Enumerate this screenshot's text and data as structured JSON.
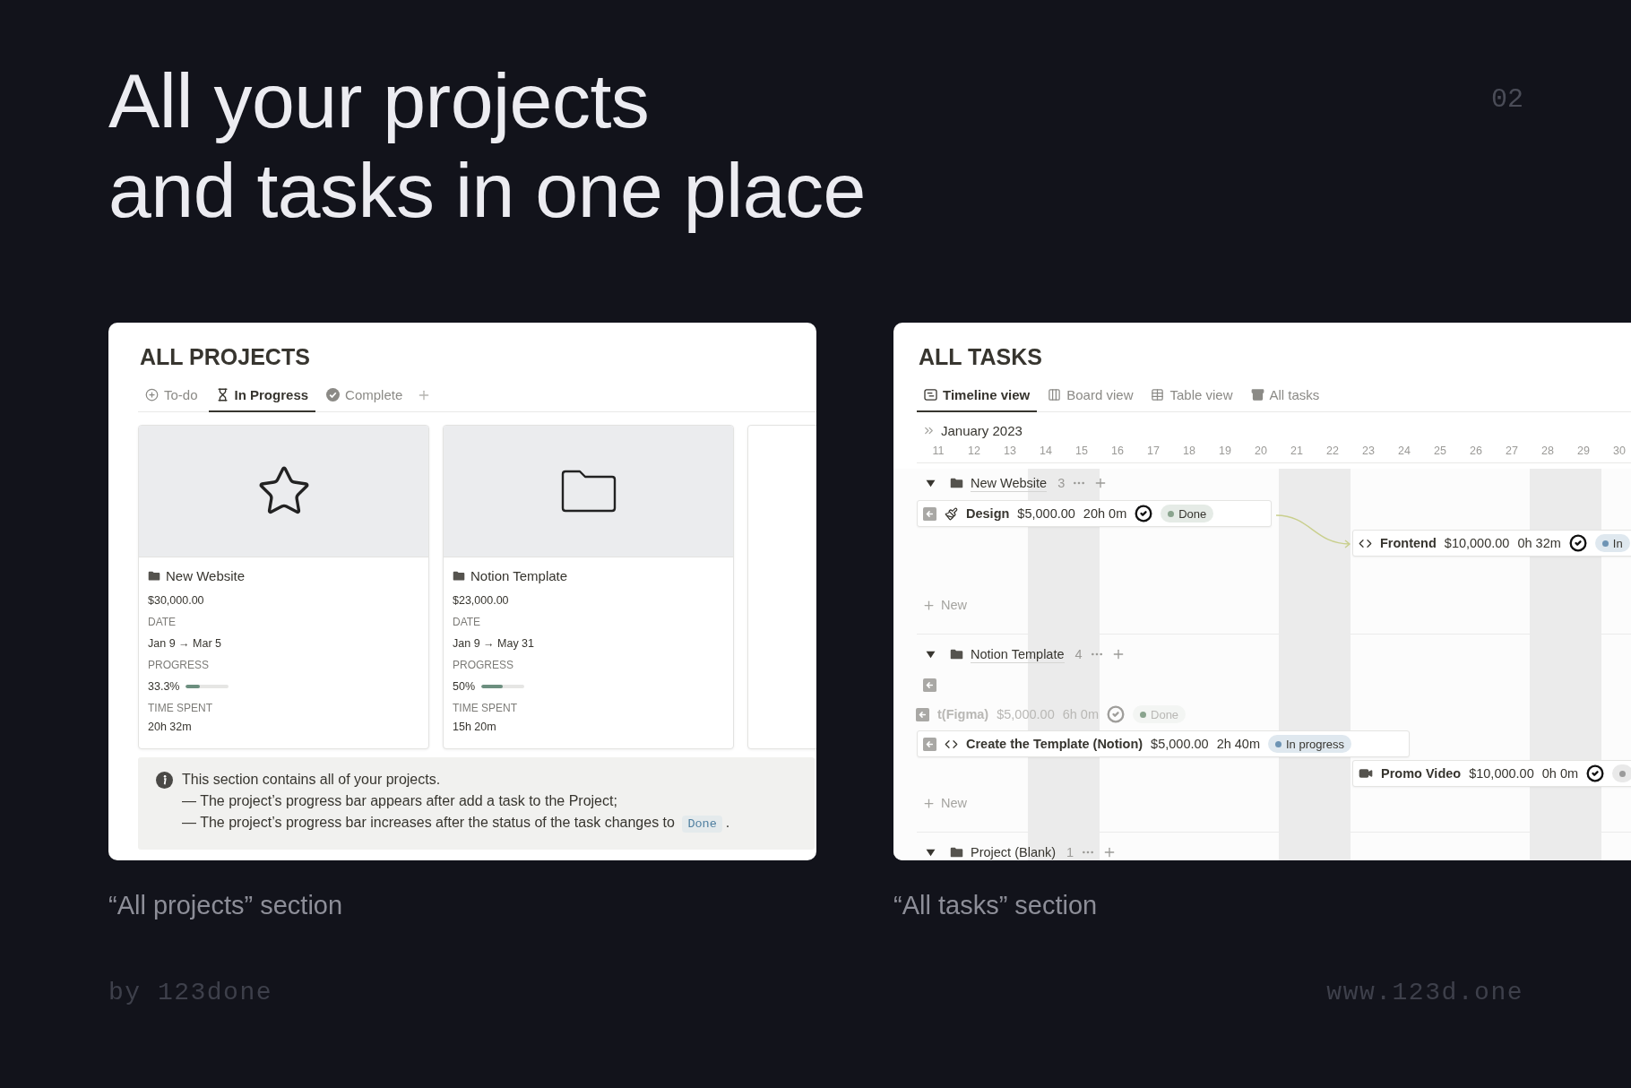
{
  "heading": {
    "lines": [
      "All your projects",
      "and tasks in one place"
    ]
  },
  "page_number": "02",
  "projects_panel": {
    "title": "ALL PROJECTS",
    "tabs": [
      {
        "label": "To-do",
        "selected": false
      },
      {
        "label": "In Progress",
        "selected": true
      },
      {
        "label": "Complete",
        "selected": false
      }
    ],
    "cards": [
      {
        "kind": "star",
        "title": "New Website",
        "amount": "$30,000.00",
        "date_label": "DATE",
        "date": "Jan 9 → Mar 5",
        "progress_label": "PROGRESS",
        "progress": "33.3%",
        "level": 0.333,
        "time_label": "TIME SPENT",
        "time": "20h 32m"
      },
      {
        "kind": "folder",
        "title": "Notion Template",
        "amount": "$23,000.00",
        "date_label": "DATE",
        "date": "Jan 9 → May 31",
        "progress_label": "PROGRESS",
        "progress": "50%",
        "level": 0.5,
        "time_label": "TIME SPENT",
        "time": "15h 20m"
      }
    ],
    "callout": {
      "lines": [
        "This section contains all of your projects.",
        "— The project’s progress bar appears after add a task to the Project;",
        "— The project’s progress bar increases after the status of the task changes to"
      ],
      "code": "Done",
      "end": "."
    }
  },
  "tasks_panel": {
    "title": "ALL TASKS",
    "tabs": [
      {
        "label": "Timeline view",
        "selected": true
      },
      {
        "label": "Board view",
        "selected": false
      },
      {
        "label": "Table view",
        "selected": false
      },
      {
        "label": "All tasks",
        "selected": false
      }
    ],
    "month": "January 2023",
    "days": [
      {
        "label": "11",
        "weekend": false
      },
      {
        "label": "12",
        "weekend": false
      },
      {
        "label": "13",
        "weekend": false
      },
      {
        "label": "14",
        "weekend": true
      },
      {
        "label": "15",
        "weekend": true
      },
      {
        "label": "16",
        "weekend": false
      },
      {
        "label": "17",
        "weekend": false
      },
      {
        "label": "18",
        "weekend": false
      },
      {
        "label": "19",
        "weekend": false
      },
      {
        "label": "20",
        "weekend": false
      },
      {
        "label": "21",
        "weekend": true
      },
      {
        "label": "22",
        "weekend": true
      },
      {
        "label": "23",
        "weekend": false
      },
      {
        "label": "24",
        "weekend": false
      },
      {
        "label": "25",
        "weekend": false
      },
      {
        "label": "26",
        "weekend": false
      },
      {
        "label": "27",
        "weekend": false
      },
      {
        "label": "28",
        "weekend": true
      },
      {
        "label": "29",
        "weekend": true
      },
      {
        "label": "30",
        "weekend": false
      }
    ],
    "groups": [
      {
        "name": "New Website",
        "count": "3",
        "expanded": true,
        "new_label": "New",
        "tasks": [
          {
            "kind": "brush",
            "handle": true,
            "shifted": false,
            "linked": false,
            "faded": false,
            "name": "Design",
            "amount": "$5,000.00",
            "time": "20h 0m",
            "checked": true,
            "status": {
              "label": "Done",
              "color": "#8aa48e"
            }
          },
          {
            "kind": "code",
            "handle": false,
            "shifted": true,
            "linked": true,
            "faded": false,
            "name": "Frontend",
            "amount": "$10,000.00",
            "time": "0h 32m",
            "checked": true,
            "status": {
              "label": "In",
              "color": "#6e94b4"
            }
          }
        ]
      },
      {
        "name": "Notion Template",
        "count": "4",
        "expanded": true,
        "new_label": "New",
        "tasks": [
          {
            "kind": "blank",
            "handle": true
          },
          {
            "kind": "blank",
            "handle": true,
            "shifted": false,
            "linked": false,
            "faded": true,
            "name": "t(Figma)",
            "amount": "$5,000.00",
            "time": "6h 0m",
            "checked": true,
            "status": {
              "label": "Done",
              "color": "#8aa48e"
            }
          },
          {
            "kind": "code",
            "handle": true,
            "shifted": false,
            "linked": false,
            "faded": false,
            "name": "Create the Template (Notion)",
            "amount": "$5,000.00",
            "time": "2h 40m",
            "checked": false,
            "status": {
              "label": "In progress",
              "color": "#6e94b4"
            }
          },
          {
            "kind": "video",
            "handle": false,
            "shifted": true,
            "linked": false,
            "faded": false,
            "name": "Promo Video",
            "amount": "$10,000.00",
            "time": "0h 0m",
            "checked": true,
            "status": {
              "color": "#9b9b9b"
            }
          }
        ]
      },
      {
        "name": "Project (Blank)",
        "count": "1",
        "expanded": true
      }
    ]
  },
  "captions": [
    "“All projects” section",
    "“All tasks” section"
  ],
  "footer": {
    "author": "by 123done",
    "site": "www.123d.one"
  }
}
